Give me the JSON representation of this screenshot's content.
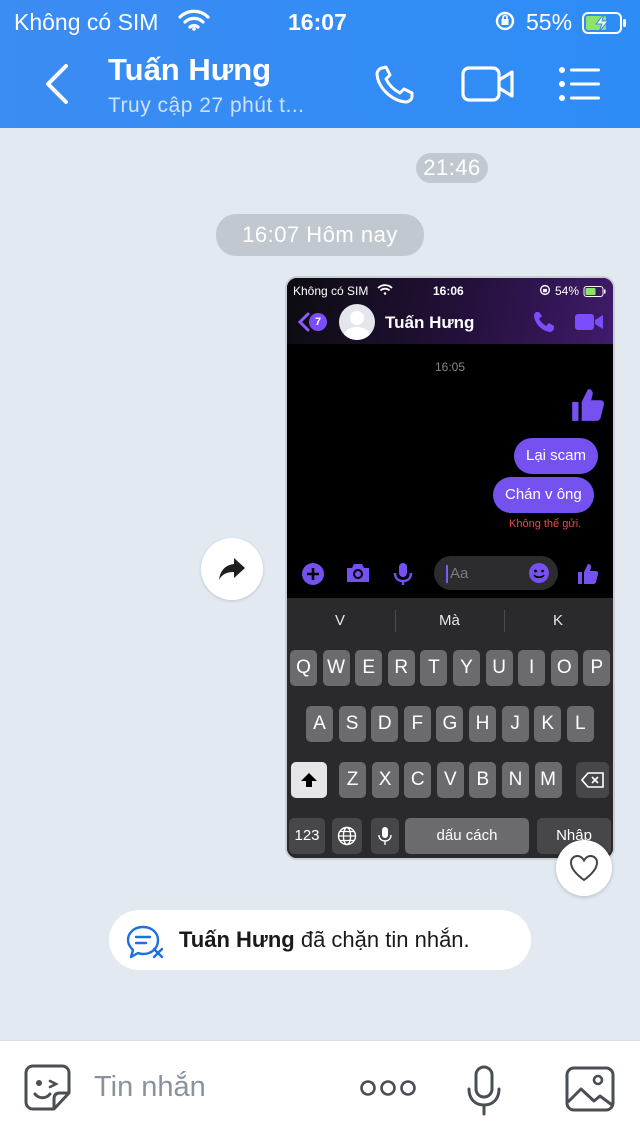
{
  "status_bar": {
    "carrier": "Không có SIM",
    "time": "16:07",
    "battery": "55%"
  },
  "header": {
    "name": "Tuấn Hưng",
    "subtitle": "Truy cập 27 phút t..."
  },
  "chat": {
    "time_pill": "21:46",
    "day_pill": "16:07 Hôm nay",
    "blocked_name": "Tuấn Hưng",
    "blocked_text": " đã chặn tin nhắn."
  },
  "screenshot": {
    "status_carrier": "Không có SIM",
    "status_time": "16:06",
    "status_battery": "54%",
    "badge": "7",
    "name": "Tuấn Hưng",
    "time_label": "16:05",
    "messages": [
      "Lại scam",
      "Chán v ông"
    ],
    "error": "Không thể gửi.",
    "input_placeholder": "Aa",
    "suggestions": [
      "V",
      "Mà",
      "K"
    ],
    "row1": [
      "Q",
      "W",
      "E",
      "R",
      "T",
      "Y",
      "U",
      "I",
      "O",
      "P"
    ],
    "row2": [
      "A",
      "S",
      "D",
      "F",
      "G",
      "H",
      "J",
      "K",
      "L"
    ],
    "row3": [
      "Z",
      "X",
      "C",
      "V",
      "B",
      "N",
      "M"
    ],
    "key_123": "123",
    "key_space": "dấu cách",
    "key_return": "Nhập"
  },
  "composer": {
    "placeholder": "Tin nhắn"
  },
  "colors": {
    "header": "#2e8cf6",
    "background": "#e2e9f1",
    "messenger_accent": "#7551f0"
  }
}
